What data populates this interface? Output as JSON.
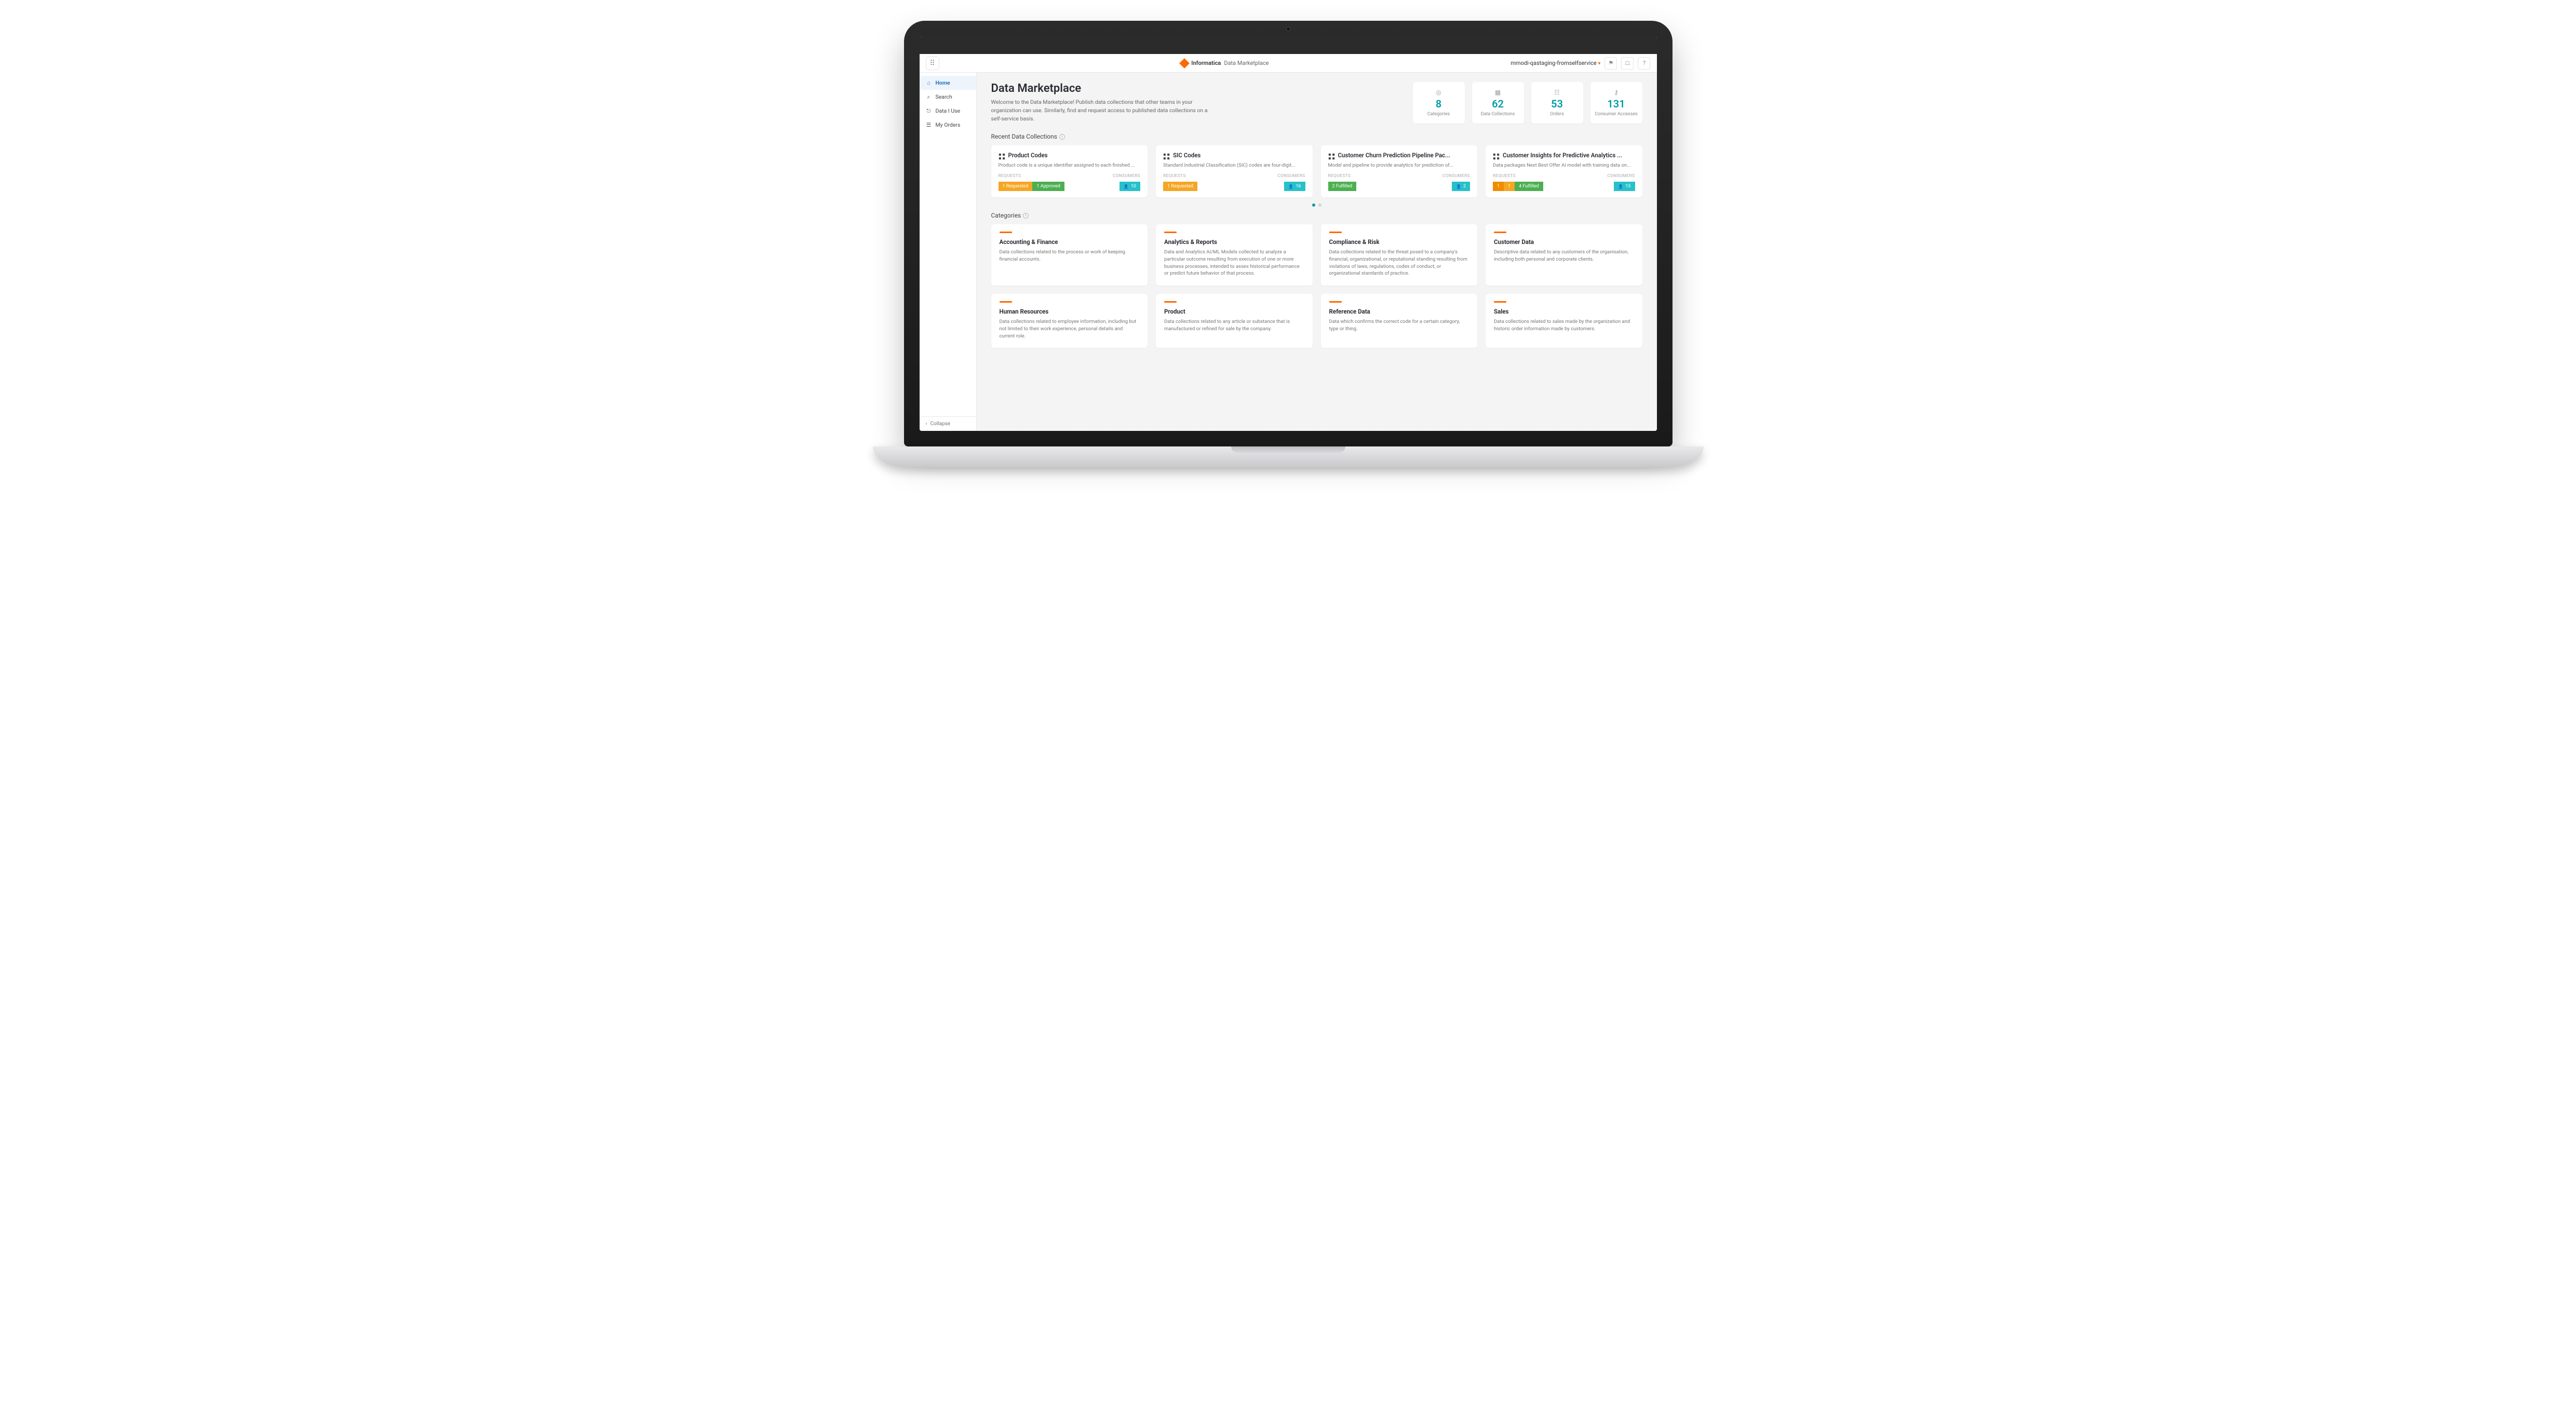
{
  "header": {
    "brand": "Informatica",
    "product": "Data Marketplace",
    "org": "mmodi-qastaging-fromselfservice"
  },
  "sidebar": {
    "items": [
      {
        "label": "Home",
        "icon": "home",
        "active": true
      },
      {
        "label": "Search",
        "icon": "search",
        "active": false
      },
      {
        "label": "Data I Use",
        "icon": "link",
        "active": false
      },
      {
        "label": "My Orders",
        "icon": "orders",
        "active": false
      }
    ],
    "collapse": "Collapse"
  },
  "page": {
    "title": "Data Marketplace",
    "description": "Welcome to the Data Marketplace! Publish data collections that other teams in your organization can use. Similarly, find and request access to published data collections on a self-service basis."
  },
  "stats": [
    {
      "value": "8",
      "label": "Categories"
    },
    {
      "value": "62",
      "label": "Data Collections"
    },
    {
      "value": "53",
      "label": "Orders"
    },
    {
      "value": "131",
      "label": "Consumer Accesses"
    }
  ],
  "sections": {
    "recent": "Recent Data Collections",
    "categories": "Categories"
  },
  "meta_labels": {
    "requests": "REQUESTS",
    "consumers": "CONSUMERS"
  },
  "collections": [
    {
      "title": "Product Codes",
      "desc": "Product code is a unique identifier assigned to each finished ...",
      "bars": [
        {
          "cls": "orange",
          "text": "1 Requested"
        },
        {
          "cls": "green",
          "text": "1 Approved"
        },
        {
          "cls": "spacer",
          "text": ""
        },
        {
          "cls": "teal",
          "text": "10"
        }
      ]
    },
    {
      "title": "SIC Codes",
      "desc": "Standard Industrial Classification (SIC) codes are four-digit...",
      "bars": [
        {
          "cls": "orange",
          "text": "1 Requested"
        },
        {
          "cls": "spacer",
          "text": ""
        },
        {
          "cls": "teal",
          "text": "16"
        }
      ]
    },
    {
      "title": "Customer Churn Prediction Pipeline Pac...",
      "desc": "Model and pipeline to provide analytics for prediction of...",
      "bars": [
        {
          "cls": "green",
          "text": "2 Fulfilled"
        },
        {
          "cls": "spacer",
          "text": ""
        },
        {
          "cls": "teal",
          "text": "2"
        }
      ]
    },
    {
      "title": "Customer Insights for Predictive Analytics ...",
      "desc": "Data packages Next Best Offer AI model with training data on...",
      "bars": [
        {
          "cls": "orange2",
          "text": "1"
        },
        {
          "cls": "orange",
          "text": "1"
        },
        {
          "cls": "green",
          "text": "4 Fulfilled"
        },
        {
          "cls": "spacer",
          "text": ""
        },
        {
          "cls": "teal",
          "text": "15"
        }
      ]
    }
  ],
  "categories": [
    {
      "title": "Accounting & Finance",
      "desc": "Data collections related to the process or work of keeping financial accounts."
    },
    {
      "title": "Analytics & Reports",
      "desc": "Data and Analytics AI/ML Models collected to analyze a particular outcome resulting from execution of one or more business processes, intended to asses historical performance or predict future behavior of that process."
    },
    {
      "title": "Compliance & Risk",
      "desc": "Data collections related to the threat posed to a company's financial, organizational, or reputational standing resulting from violations of laws, regulations, codes of conduct, or organizational standards of practice."
    },
    {
      "title": "Customer Data",
      "desc": "Descriptive data related to any customers of the organisation, including both personal and corporate clients."
    },
    {
      "title": "Human Resources",
      "desc": "Data collections related to employee information, including but not limited to their work experience, personal details and current role."
    },
    {
      "title": "Product",
      "desc": "Data collections related to any article or substance that is manufactured or refined for sale by the company."
    },
    {
      "title": "Reference Data",
      "desc": "Data which confirms the correct code for a certain category, type or thing."
    },
    {
      "title": "Sales",
      "desc": "Data collections related to sales made by the organization and historic order information made by customers."
    }
  ]
}
